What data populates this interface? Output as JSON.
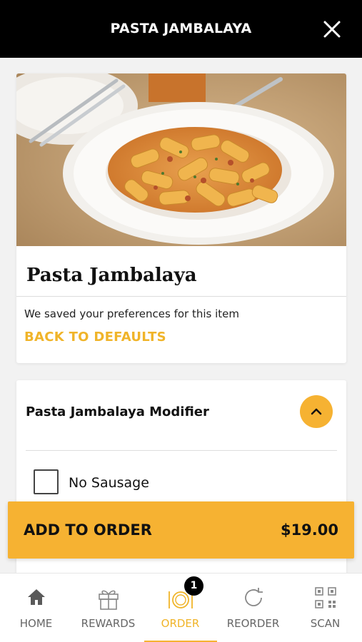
{
  "header": {
    "title": "PASTA JAMBALAYA"
  },
  "item": {
    "title": "Pasta Jambalaya",
    "saved_text": "We saved your preferences for this item",
    "back_defaults": "BACK TO DEFAULTS"
  },
  "modifier": {
    "title": "Pasta Jambalaya Modifier",
    "options": [
      {
        "label": "No Sausage",
        "checked": false
      }
    ]
  },
  "add_to_order": {
    "label": "ADD TO ORDER",
    "price": "$19.00"
  },
  "tabs": [
    {
      "label": "HOME",
      "icon": "home-icon"
    },
    {
      "label": "REWARDS",
      "icon": "gift-icon"
    },
    {
      "label": "ORDER",
      "icon": "plate-icon",
      "active": true,
      "badge": "1"
    },
    {
      "label": "REORDER",
      "icon": "refresh-icon"
    },
    {
      "label": "SCAN",
      "icon": "qr-code-icon"
    }
  ],
  "colors": {
    "accent": "#f6b232",
    "accent_text": "#f0b429",
    "header_bg": "#000000"
  }
}
